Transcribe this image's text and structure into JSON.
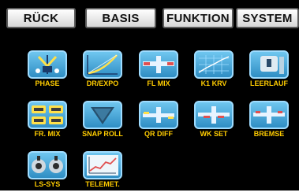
{
  "tabs": [
    {
      "label": "RÜCK"
    },
    {
      "label": "BASIS"
    },
    {
      "label": "FUNKTION"
    },
    {
      "label": "SYSTEM"
    }
  ],
  "menu": [
    {
      "label": "PHASE",
      "icon": "phase-icon"
    },
    {
      "label": "DR/EXPO",
      "icon": "expo-curve-icon"
    },
    {
      "label": "FL MIX",
      "icon": "wing-mixer-icon"
    },
    {
      "label": "K1 KRV",
      "icon": "throttle-curve-icon"
    },
    {
      "label": "LEERLAUF",
      "icon": "idle-switch-icon"
    },
    {
      "label": "FR. MIX",
      "icon": "free-mixer-icon"
    },
    {
      "label": "SNAP ROLL",
      "icon": "snap-roll-icon"
    },
    {
      "label": "QR DIFF",
      "icon": "aileron-differential-icon"
    },
    {
      "label": "WK SET",
      "icon": "flap-settings-icon"
    },
    {
      "label": "BREMSE",
      "icon": "brake-airplane-icon"
    },
    {
      "label": "LS-SYS",
      "icon": "servo-system-icon"
    },
    {
      "label": "TELEMET.",
      "icon": "telemetry-chart-icon"
    }
  ]
}
